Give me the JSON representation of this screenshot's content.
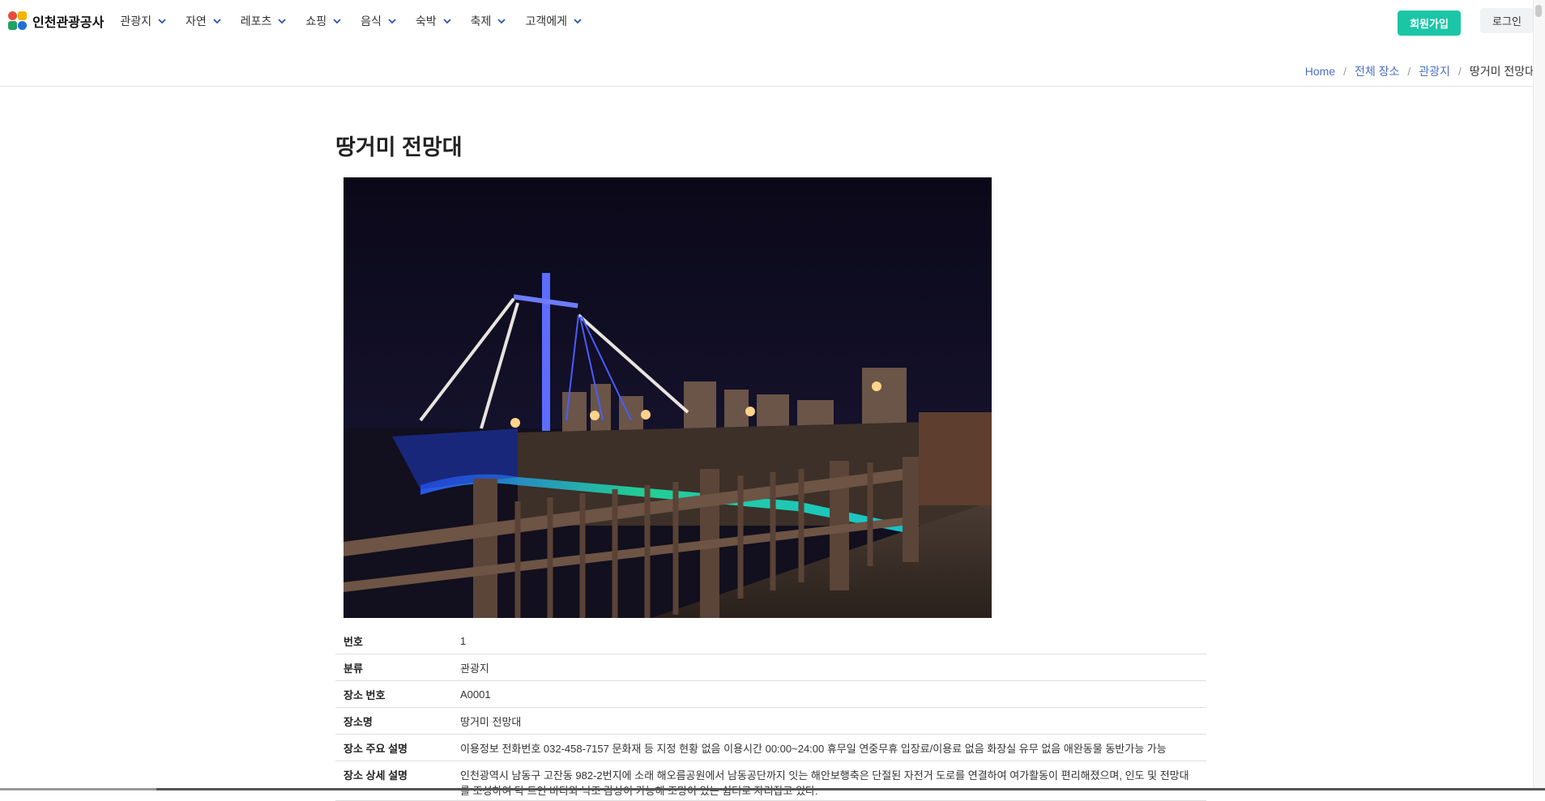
{
  "header": {
    "brand": "인천관광공사",
    "menu": [
      "관광지",
      "자연",
      "레포츠",
      "쇼핑",
      "음식",
      "숙박",
      "축제",
      "고객에게"
    ],
    "signup_label": "회원가입",
    "login_label": "로그인"
  },
  "breadcrumb": {
    "home": "Home",
    "all_places": "전체 장소",
    "category": "관광지",
    "current": "땅거미 전망대"
  },
  "main": {
    "title": "땅거미 전망대",
    "details": [
      {
        "label": "번호",
        "value": "1"
      },
      {
        "label": "분류",
        "value": "관광지"
      },
      {
        "label": "장소 번호",
        "value": "A0001"
      },
      {
        "label": "장소명",
        "value": "땅거미 전망대"
      },
      {
        "label": "장소 주요 설명",
        "value": "이용정보 전화번호 032-458-7157 문화재 등 지정 현황 없음 이용시간 00:00~24:00 휴무일 연중무휴 입장료/이용료 없음 화장실 유무 없음 애완동물 동반가능 가능"
      },
      {
        "label": "장소 상세 설명",
        "value": "인천광역시 남동구 고잔동 982-2번지에 소래 해오름공원에서 남동공단까지 잇는 해안보행축은 단절된 자전거 도로를 연결하여 여가활동이 편리해졌으며, 인도 및 전망대를 조성하여 탁 트인 바다와 낙조 감상이 가능해 조망이 있는 쉼터로 자리잡고 있다."
      }
    ]
  },
  "colors": {
    "accent": "#1bc6a6",
    "link": "#4a6fc7"
  },
  "icons": {
    "menu_chevron": "chevron-down-icon"
  }
}
